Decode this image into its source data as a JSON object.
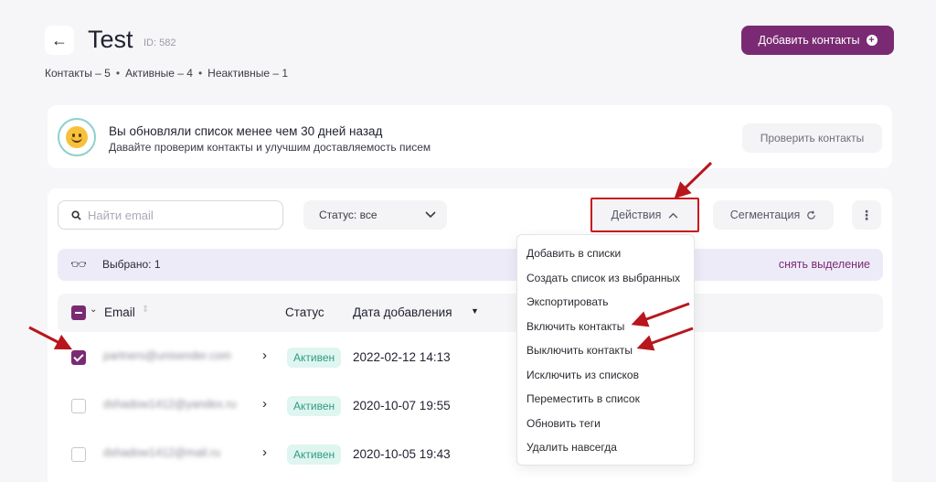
{
  "header": {
    "back_icon": "arrow-left-icon",
    "title": "Test",
    "id_label": "ID: 582",
    "add_button_label": "Добавить контакты",
    "add_icon": "plus-circle-icon",
    "accent_color": "#7a2a73"
  },
  "stats": {
    "contacts": "Контакты – 5",
    "active": "Активные – 4",
    "inactive": "Неактивные – 1",
    "separator": "•"
  },
  "banner": {
    "icon": "smiley-icon",
    "title": "Вы обновляли список менее чем 30 дней назад",
    "subtitle": "Давайте проверим контакты и улучшим доставляемость писем",
    "button_label": "Проверить контакты"
  },
  "toolbar": {
    "search_icon": "search-icon",
    "search_placeholder": "Найти email",
    "search_value": "",
    "status_filter_label": "Статус: все",
    "actions_label": "Действия",
    "segmentation_label": "Сегментация",
    "more_icon": "more-vertical-icon"
  },
  "selection": {
    "icon": "glasses-icon",
    "label": "Выбрано: 1",
    "clear_label": "снять выделение"
  },
  "table": {
    "headers": {
      "email": "Email",
      "status": "Статус",
      "date": "Дата добавления"
    },
    "rows": [
      {
        "checked": true,
        "email": "partners@unisender.com",
        "status": "Активен",
        "date": "2022-02-12 14:13"
      },
      {
        "checked": false,
        "email": "dshadow1412@yandex.ru",
        "status": "Активен",
        "date": "2020-10-07 19:55"
      },
      {
        "checked": false,
        "email": "dshadow1412@mail.ru",
        "status": "Активен",
        "date": "2020-10-05 19:43"
      }
    ]
  },
  "actions_menu": {
    "items": [
      "Добавить в списки",
      "Создать список из выбранных",
      "Экспортировать",
      "Включить контакты",
      "Выключить контакты",
      "Исключить из списков",
      "Переместить в список",
      "Обновить теги",
      "Удалить навсегда"
    ]
  },
  "annotation_color": "#c9161c",
  "status_badge_color": "#2e9c82"
}
